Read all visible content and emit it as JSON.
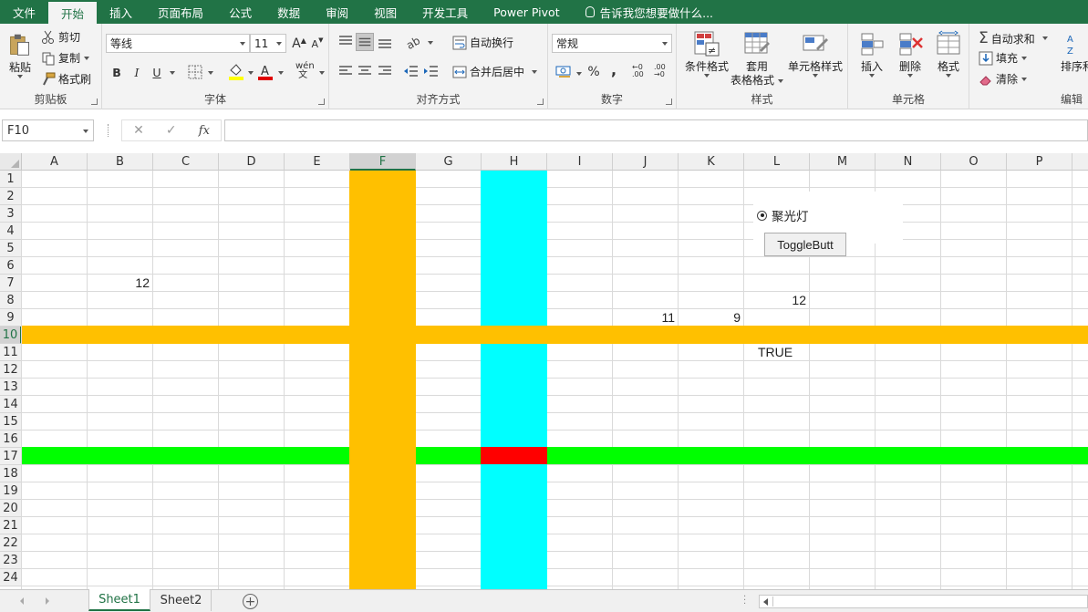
{
  "menu_tabs": [
    {
      "label": "文件",
      "active": false
    },
    {
      "label": "开始",
      "active": true
    },
    {
      "label": "插入",
      "active": false
    },
    {
      "label": "页面布局",
      "active": false
    },
    {
      "label": "公式",
      "active": false
    },
    {
      "label": "数据",
      "active": false
    },
    {
      "label": "审阅",
      "active": false
    },
    {
      "label": "视图",
      "active": false
    },
    {
      "label": "开发工具",
      "active": false
    },
    {
      "label": "Power Pivot",
      "active": false
    }
  ],
  "tell_me": "告诉我您想要做什么...",
  "ribbon": {
    "clipboard": {
      "paste": "粘贴",
      "cut": "剪切",
      "copy": "复制",
      "format_painter": "格式刷",
      "label": "剪贴板"
    },
    "font": {
      "name": "等线",
      "size": "11",
      "bold": "B",
      "italic": "I",
      "underline": "U",
      "grow": "A",
      "shrink": "A",
      "label": "字体"
    },
    "alignment": {
      "wrap": "自动换行",
      "merge": "合并后居中",
      "label": "对齐方式"
    },
    "number": {
      "format": "常规",
      "percent": "%",
      "comma": ",",
      "label": "数字"
    },
    "styles": {
      "conditional": "条件格式",
      "table_line1": "套用",
      "table_line2": "表格格式",
      "cell_styles": "单元格样式",
      "label": "样式"
    },
    "cells": {
      "insert": "插入",
      "delete": "删除",
      "format": "格式",
      "label": "单元格"
    },
    "editing": {
      "autosum": "自动求和",
      "fill": "填充",
      "clear": "清除",
      "sort": "排序和",
      "label": "编辑"
    }
  },
  "formula_bar": {
    "name_box": "F10",
    "cancel": "✕",
    "enter": "✓",
    "fx": "fx",
    "formula": ""
  },
  "columns": [
    "A",
    "B",
    "C",
    "D",
    "E",
    "F",
    "G",
    "H",
    "I",
    "J",
    "K",
    "L",
    "M",
    "N",
    "O",
    "P"
  ],
  "rows": [
    "1",
    "2",
    "3",
    "4",
    "5",
    "6",
    "7",
    "8",
    "9",
    "10",
    "11",
    "12",
    "13",
    "14",
    "15",
    "16",
    "17",
    "18",
    "19",
    "20",
    "21",
    "22",
    "23",
    "24"
  ],
  "active_cell": {
    "column": "F",
    "row": "10"
  },
  "highlight_colors": {
    "column_F": "#ffc000",
    "row_10": "#ffc000",
    "column_H": "#00ffff",
    "row_17": "#00ff00",
    "intersection_H17": "#ff0000"
  },
  "cell_values": [
    {
      "cell": "B7",
      "value": "12"
    },
    {
      "cell": "L8",
      "value": "12"
    },
    {
      "cell": "J9",
      "value": "11"
    },
    {
      "cell": "K9",
      "value": "9"
    },
    {
      "cell": "L11",
      "value": "TRUE"
    }
  ],
  "controls": {
    "option_button": {
      "label": "聚光灯",
      "checked": true
    },
    "toggle_button": {
      "label": "ToggleButt"
    }
  },
  "sheets": [
    {
      "name": "Sheet1",
      "active": true
    },
    {
      "name": "Sheet2",
      "active": false
    }
  ],
  "add_sheet": "+"
}
